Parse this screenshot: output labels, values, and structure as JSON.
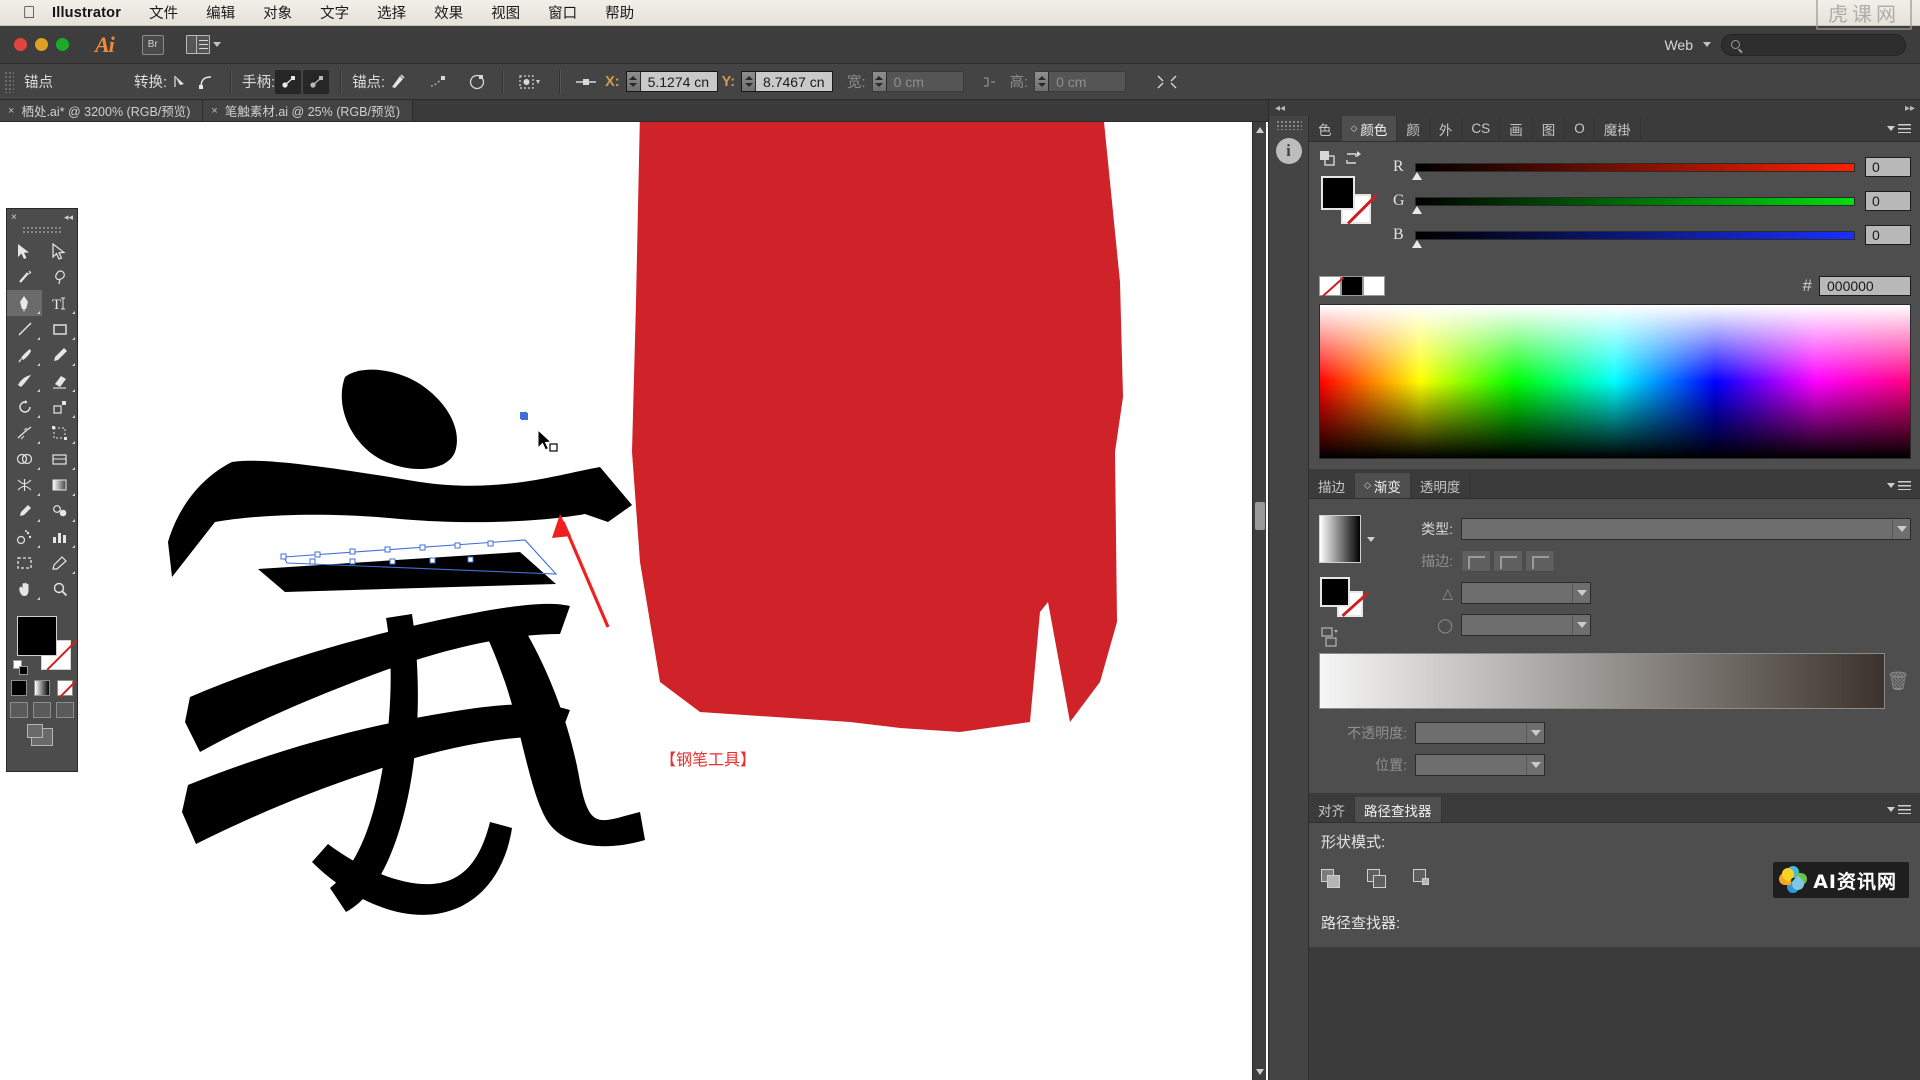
{
  "mac_menu": {
    "app_name": "Illustrator",
    "apple_icon": "apple-logo",
    "items": [
      "文件",
      "编辑",
      "对象",
      "文字",
      "选择",
      "效果",
      "视图",
      "窗口",
      "帮助"
    ],
    "watermark_right": "虎课网"
  },
  "appbar": {
    "logo": "Ai",
    "bridge_label": "Br",
    "arrange_icon": "arrange-documents-icon",
    "workspace": "Web",
    "search_icon": "search-icon"
  },
  "control_bar": {
    "context_label": "锚点",
    "convert_label": "转换:",
    "convert_icons": [
      "convert-to-corner-icon",
      "convert-to-smooth-icon"
    ],
    "handles_label": "手柄:",
    "handle_icons": [
      "show-handles-icon",
      "hide-handles-icon"
    ],
    "anchor_label": "锚点:",
    "anchor_icons": [
      "remove-anchor-icon",
      "connect-anchor-icon",
      "cut-path-icon"
    ],
    "isolate_icon": "isolate-selected-icon",
    "align_icon": "align-icon",
    "x_label": "X:",
    "x_value": "5.1274 cn",
    "y_label": "Y:",
    "y_value": "8.7467 cn",
    "w_label": "宽:",
    "w_value": "0 cm",
    "link_icon": "constrain-proportions-icon",
    "h_label": "高:",
    "h_value": "0 cm",
    "transform_icon": "transform-each-icon"
  },
  "document_tabs": [
    {
      "close": "×",
      "title": "栖处.ai* @ 3200% (RGB/预览)",
      "active": true
    },
    {
      "close": "×",
      "title": "笔触素材.ai @ 25% (RGB/预览)",
      "active": false
    }
  ],
  "tools": {
    "close": "×",
    "collapse": "◂◂",
    "items": [
      "selection-tool",
      "direct-selection-tool",
      "magic-wand-tool",
      "lasso-tool",
      "pen-tool",
      "type-tool",
      "line-segment-tool",
      "rectangle-tool",
      "paintbrush-tool",
      "pencil-tool",
      "blob-brush-tool",
      "eraser-tool",
      "rotate-tool",
      "scale-tool",
      "width-tool",
      "free-transform-tool",
      "shape-builder-tool",
      "perspective-grid-tool",
      "mesh-tool",
      "gradient-tool",
      "eyedropper-tool",
      "blend-tool",
      "symbol-sprayer-tool",
      "column-graph-tool",
      "artboard-tool",
      "slice-tool",
      "hand-tool",
      "zoom-tool"
    ],
    "selected_index": 4,
    "fill_color": "#000000",
    "stroke_color": "#ffffff",
    "bottom_modes": [
      "normal-screen-mode",
      "full-screen-menu-mode",
      "full-screen-mode"
    ]
  },
  "canvas": {
    "glyph": "家",
    "glyph_color": "#000000",
    "red_shape_color": "#cf2229",
    "annotation_text": "【钢笔工具】",
    "annotation_color": "#ef2b2b",
    "arrow_color": "#ee2020",
    "selection_color": "#3f6fd8",
    "cursor_icon": "pen-cursor"
  },
  "right_panel": {
    "collapse_left_icon": "◂◂",
    "collapse_right_icon": "▸▸",
    "icon_strip": [
      "info-panel-icon"
    ],
    "color_panel": {
      "tabs": [
        "色",
        "颜色",
        "颜",
        "外",
        "CS",
        "画",
        "图",
        "O",
        "魔褂"
      ],
      "active_tab": "颜色",
      "menu_icon": "panel-menu-icon",
      "swap_icon": "swap-fill-stroke-icon",
      "default_icon": "default-fill-stroke-icon",
      "fill_color": "#000000",
      "stroke_color": "#ffffff",
      "channels": [
        {
          "label": "R",
          "value": "0"
        },
        {
          "label": "G",
          "value": "0"
        },
        {
          "label": "B",
          "value": "0"
        }
      ],
      "hex_symbol": "#",
      "hex_value": "000000",
      "ramp_none": "none-swatch",
      "ramp_black": "#000000",
      "ramp_white": "#ffffff"
    },
    "gradient_panel": {
      "tabs": [
        "描边",
        "渐变",
        "透明度"
      ],
      "active_tab": "渐变",
      "menu_icon": "panel-menu-icon",
      "type_label": "类型:",
      "type_value": "",
      "stroke_label": "描边:",
      "stroke_buttons": [
        "gradient-within-stroke",
        "gradient-along-stroke",
        "gradient-across-stroke"
      ],
      "angle_label": "",
      "angle_value": "",
      "aspect_label": "",
      "aspect_value": "",
      "gradient_preview": "linear-white-to-brown",
      "delete_icon": "trash-icon",
      "opacity_label": "不透明度:",
      "opacity_value": "",
      "location_label": "位置:",
      "location_value": ""
    },
    "pathfinder_panel": {
      "tabs": [
        "对齐",
        "路径查找器"
      ],
      "active_tab": "路径查找器",
      "menu_icon": "panel-menu-icon",
      "shape_modes_label": "形状模式:",
      "shape_mode_buttons": [
        "unite-icon",
        "minus-front-icon",
        "intersect-icon",
        "exclude-icon"
      ],
      "pathfinders_label": "路径查找器:",
      "watermark": "AI资讯网"
    }
  }
}
